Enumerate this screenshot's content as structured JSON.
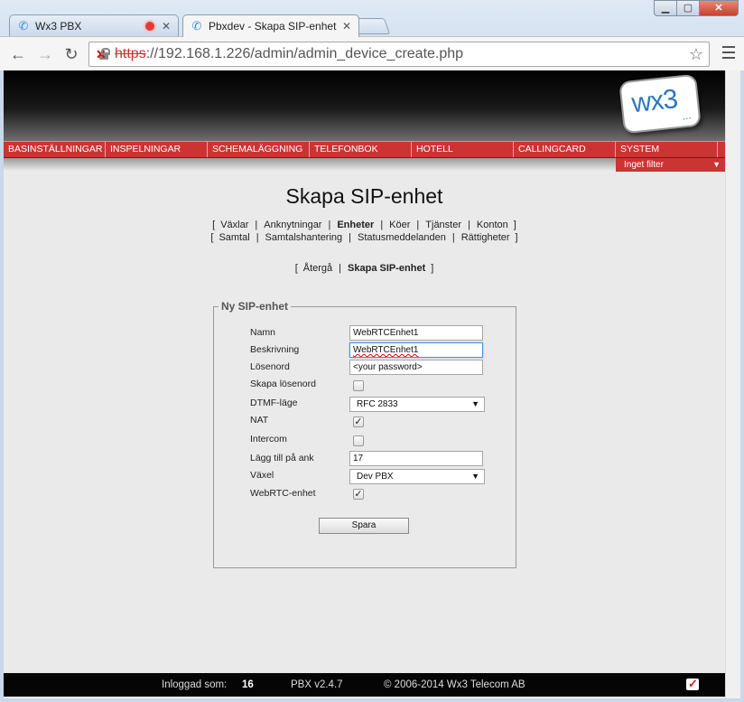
{
  "browser": {
    "tabs": [
      {
        "title": "Wx3 PBX",
        "active": false,
        "recording": true
      },
      {
        "title": "Pbxdev - Skapa SIP-enhet",
        "active": true,
        "recording": false
      }
    ],
    "url_scheme": "https",
    "url_rest": "://192.168.1.226/admin/admin_device_create.php"
  },
  "nav": {
    "items": [
      "BASINSTÄLLNINGAR",
      "INSPELNINGAR",
      "SCHEMALÄGGNING",
      "TELEFONBOK",
      "HOTELL",
      "CALLINGCARD",
      "SYSTEM"
    ],
    "filter": "Inget filter"
  },
  "logo": {
    "text": "wx3",
    "dots": "..."
  },
  "page": {
    "title": "Skapa SIP-enhet",
    "links_row1": [
      "Växlar",
      "Anknytningar",
      "Enheter",
      "Köer",
      "Tjänster",
      "Konton"
    ],
    "links_row2": [
      "Samtal",
      "Samtalshantering",
      "Statusmeddelanden",
      "Rättigheter"
    ],
    "back_link": "Återgå",
    "current": "Skapa SIP-enhet"
  },
  "form": {
    "legend": "Ny SIP-enhet",
    "labels": {
      "namn": "Namn",
      "beskrivning": "Beskrivning",
      "losenord": "Lösenord",
      "skapa_losenord": "Skapa lösenord",
      "dtmf": "DTMF-läge",
      "nat": "NAT",
      "intercom": "Intercom",
      "lagg_till": "Lägg till på ank",
      "vaxel": "Växel",
      "webrtc": "WebRTC-enhet"
    },
    "values": {
      "namn": "WebRTCEnhet1",
      "beskrivning": "WebRTCEnhet1",
      "losenord": "<your password>",
      "dtmf": "RFC 2833",
      "lagg_till": "17",
      "vaxel": "Dev PBX"
    },
    "checks": {
      "skapa_losenord": false,
      "nat": true,
      "intercom": false,
      "webrtc": true
    },
    "save": "Spara"
  },
  "footer": {
    "logged_label": "Inloggad som:",
    "logged_user": "16",
    "version": "PBX v2.4.7",
    "copyright": "© 2006-2014 Wx3 Telecom AB"
  }
}
